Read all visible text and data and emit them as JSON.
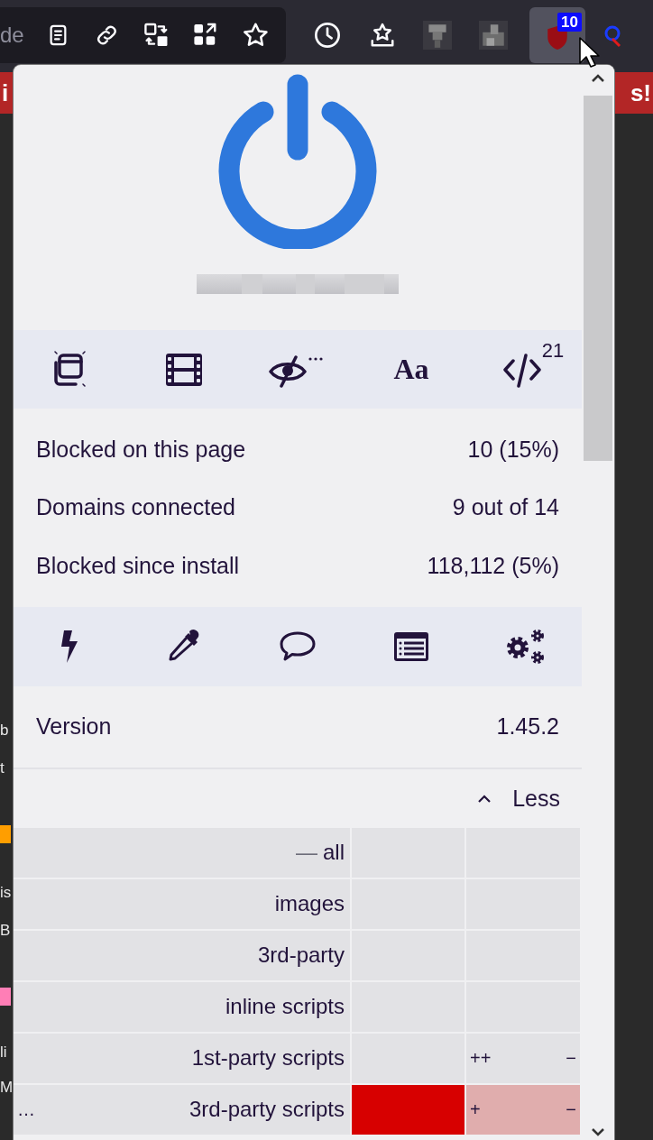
{
  "browser_toolbar": {
    "address_fragment": "de",
    "extension_badge": "10"
  },
  "background_page": {
    "banner_left": "i",
    "banner_right": "s!",
    "left_fragments": [
      {
        "text": "b"
      },
      {
        "text": "t"
      },
      {
        "text": "is"
      },
      {
        "text": "B"
      },
      {
        "text": "li"
      },
      {
        "text": "M"
      }
    ]
  },
  "popup": {
    "power_enabled": true,
    "quick_tools": [
      {
        "kind": "popups"
      },
      {
        "kind": "media"
      },
      {
        "kind": "cosmetic",
        "more": true
      },
      {
        "kind": "fonts",
        "label": "Aa"
      },
      {
        "kind": "scripts",
        "count": "21"
      }
    ],
    "stats": [
      {
        "label": "Blocked on this page",
        "value": "10 (15%)"
      },
      {
        "label": "Domains connected",
        "value": "9 out of 14"
      },
      {
        "label": "Blocked since install",
        "value": "118,112 (5%)"
      }
    ],
    "tools": [
      {
        "kind": "zap"
      },
      {
        "kind": "picker"
      },
      {
        "kind": "report"
      },
      {
        "kind": "logger"
      },
      {
        "kind": "dashboard"
      }
    ],
    "version": {
      "label": "Version",
      "value": "1.45.2"
    },
    "details_toggle": {
      "label": "Less",
      "expanded": true
    },
    "firewall": [
      {
        "label": "all",
        "marker": "—",
        "global_blocked": false,
        "local_blocked": false
      },
      {
        "label": "images",
        "global_blocked": false,
        "local_blocked": false
      },
      {
        "label": "3rd-party",
        "global_blocked": false,
        "local_blocked": false
      },
      {
        "label": "inline scripts",
        "global_blocked": false,
        "local_blocked": false
      },
      {
        "label": "1st-party scripts",
        "global_blocked": false,
        "local_blocked": false,
        "local_left": "++",
        "local_right": "−"
      },
      {
        "label": "3rd-party scripts",
        "more": "…",
        "global_blocked": true,
        "local_blocked": true,
        "local_left": "+",
        "local_right": "−"
      }
    ]
  }
}
